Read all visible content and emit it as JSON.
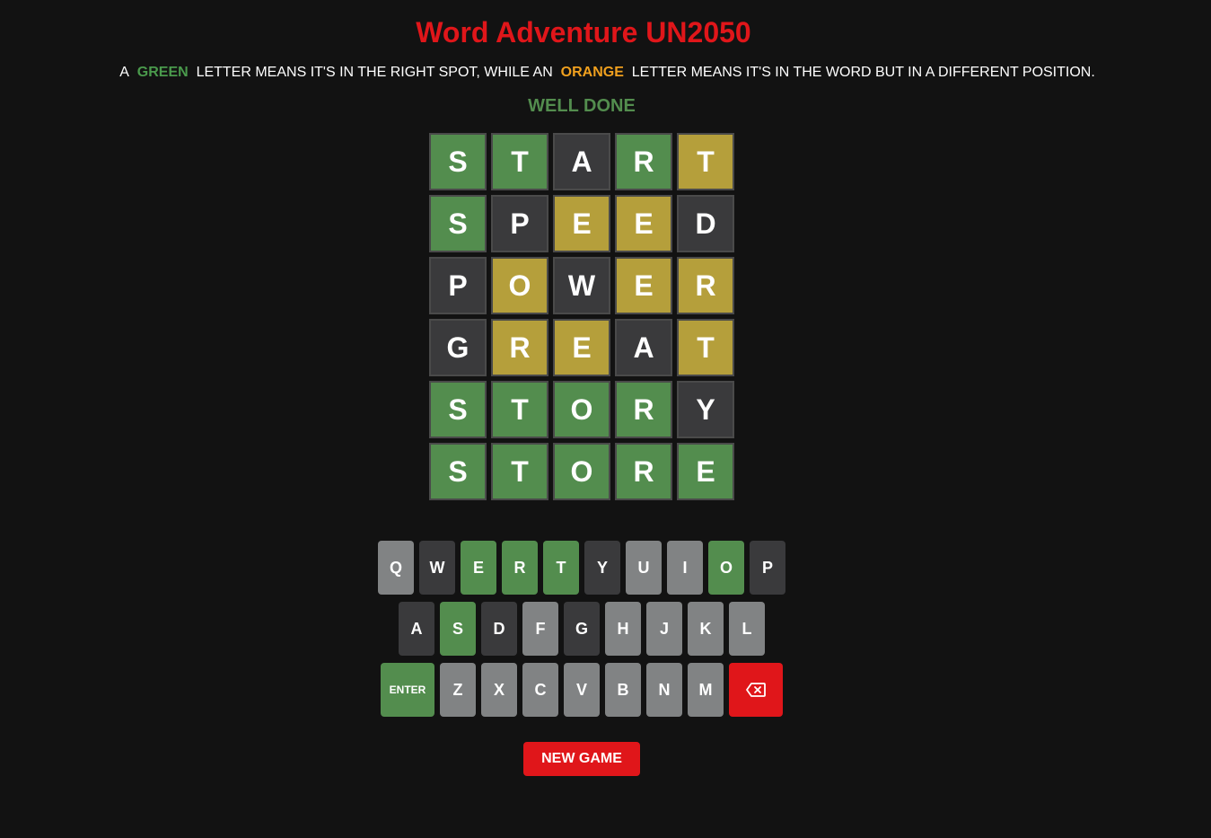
{
  "app": {
    "title": "Word Adventure UN2050"
  },
  "instructions": {
    "prefix": "A",
    "green_word": "GREEN",
    "middle": "LETTER MEANS IT'S IN THE RIGHT SPOT, WHILE AN",
    "orange_word": "ORANGE",
    "suffix": "LETTER MEANS IT'S IN THE WORD BUT IN A DIFFERENT POSITION."
  },
  "status": {
    "message": "WELL DONE"
  },
  "colors": {
    "correct": "#538d4e",
    "present": "#b59f3b",
    "absent": "#3a3a3c",
    "unused": "#818384",
    "accent_red": "#e0161a"
  },
  "board": {
    "rows": [
      [
        {
          "letter": "S",
          "state": "correct"
        },
        {
          "letter": "T",
          "state": "correct"
        },
        {
          "letter": "A",
          "state": "absent"
        },
        {
          "letter": "R",
          "state": "correct"
        },
        {
          "letter": "T",
          "state": "present"
        }
      ],
      [
        {
          "letter": "S",
          "state": "correct"
        },
        {
          "letter": "P",
          "state": "absent"
        },
        {
          "letter": "E",
          "state": "present"
        },
        {
          "letter": "E",
          "state": "present"
        },
        {
          "letter": "D",
          "state": "absent"
        }
      ],
      [
        {
          "letter": "P",
          "state": "absent"
        },
        {
          "letter": "O",
          "state": "present"
        },
        {
          "letter": "W",
          "state": "absent"
        },
        {
          "letter": "E",
          "state": "present"
        },
        {
          "letter": "R",
          "state": "present"
        }
      ],
      [
        {
          "letter": "G",
          "state": "absent"
        },
        {
          "letter": "R",
          "state": "present"
        },
        {
          "letter": "E",
          "state": "present"
        },
        {
          "letter": "A",
          "state": "absent"
        },
        {
          "letter": "T",
          "state": "present"
        }
      ],
      [
        {
          "letter": "S",
          "state": "correct"
        },
        {
          "letter": "T",
          "state": "correct"
        },
        {
          "letter": "O",
          "state": "correct"
        },
        {
          "letter": "R",
          "state": "correct"
        },
        {
          "letter": "Y",
          "state": "absent"
        }
      ],
      [
        {
          "letter": "S",
          "state": "correct"
        },
        {
          "letter": "T",
          "state": "correct"
        },
        {
          "letter": "O",
          "state": "correct"
        },
        {
          "letter": "R",
          "state": "correct"
        },
        {
          "letter": "E",
          "state": "correct"
        }
      ]
    ]
  },
  "keyboard": {
    "rows": [
      [
        {
          "label": "Q",
          "state": "unused"
        },
        {
          "label": "W",
          "state": "absent"
        },
        {
          "label": "E",
          "state": "correct"
        },
        {
          "label": "R",
          "state": "correct"
        },
        {
          "label": "T",
          "state": "correct"
        },
        {
          "label": "Y",
          "state": "absent"
        },
        {
          "label": "U",
          "state": "unused"
        },
        {
          "label": "I",
          "state": "unused"
        },
        {
          "label": "O",
          "state": "correct"
        },
        {
          "label": "P",
          "state": "absent"
        }
      ],
      [
        {
          "label": "A",
          "state": "absent"
        },
        {
          "label": "S",
          "state": "correct"
        },
        {
          "label": "D",
          "state": "absent"
        },
        {
          "label": "F",
          "state": "unused"
        },
        {
          "label": "G",
          "state": "absent"
        },
        {
          "label": "H",
          "state": "unused"
        },
        {
          "label": "J",
          "state": "unused"
        },
        {
          "label": "K",
          "state": "unused"
        },
        {
          "label": "L",
          "state": "unused"
        }
      ],
      [
        {
          "label": "ENTER",
          "state": "enter"
        },
        {
          "label": "Z",
          "state": "unused"
        },
        {
          "label": "X",
          "state": "unused"
        },
        {
          "label": "C",
          "state": "unused"
        },
        {
          "label": "V",
          "state": "unused"
        },
        {
          "label": "B",
          "state": "unused"
        },
        {
          "label": "N",
          "state": "unused"
        },
        {
          "label": "M",
          "state": "unused"
        },
        {
          "label": "",
          "state": "backspace",
          "icon": "backspace-icon"
        }
      ]
    ]
  },
  "actions": {
    "new_game_label": "NEW GAME"
  }
}
